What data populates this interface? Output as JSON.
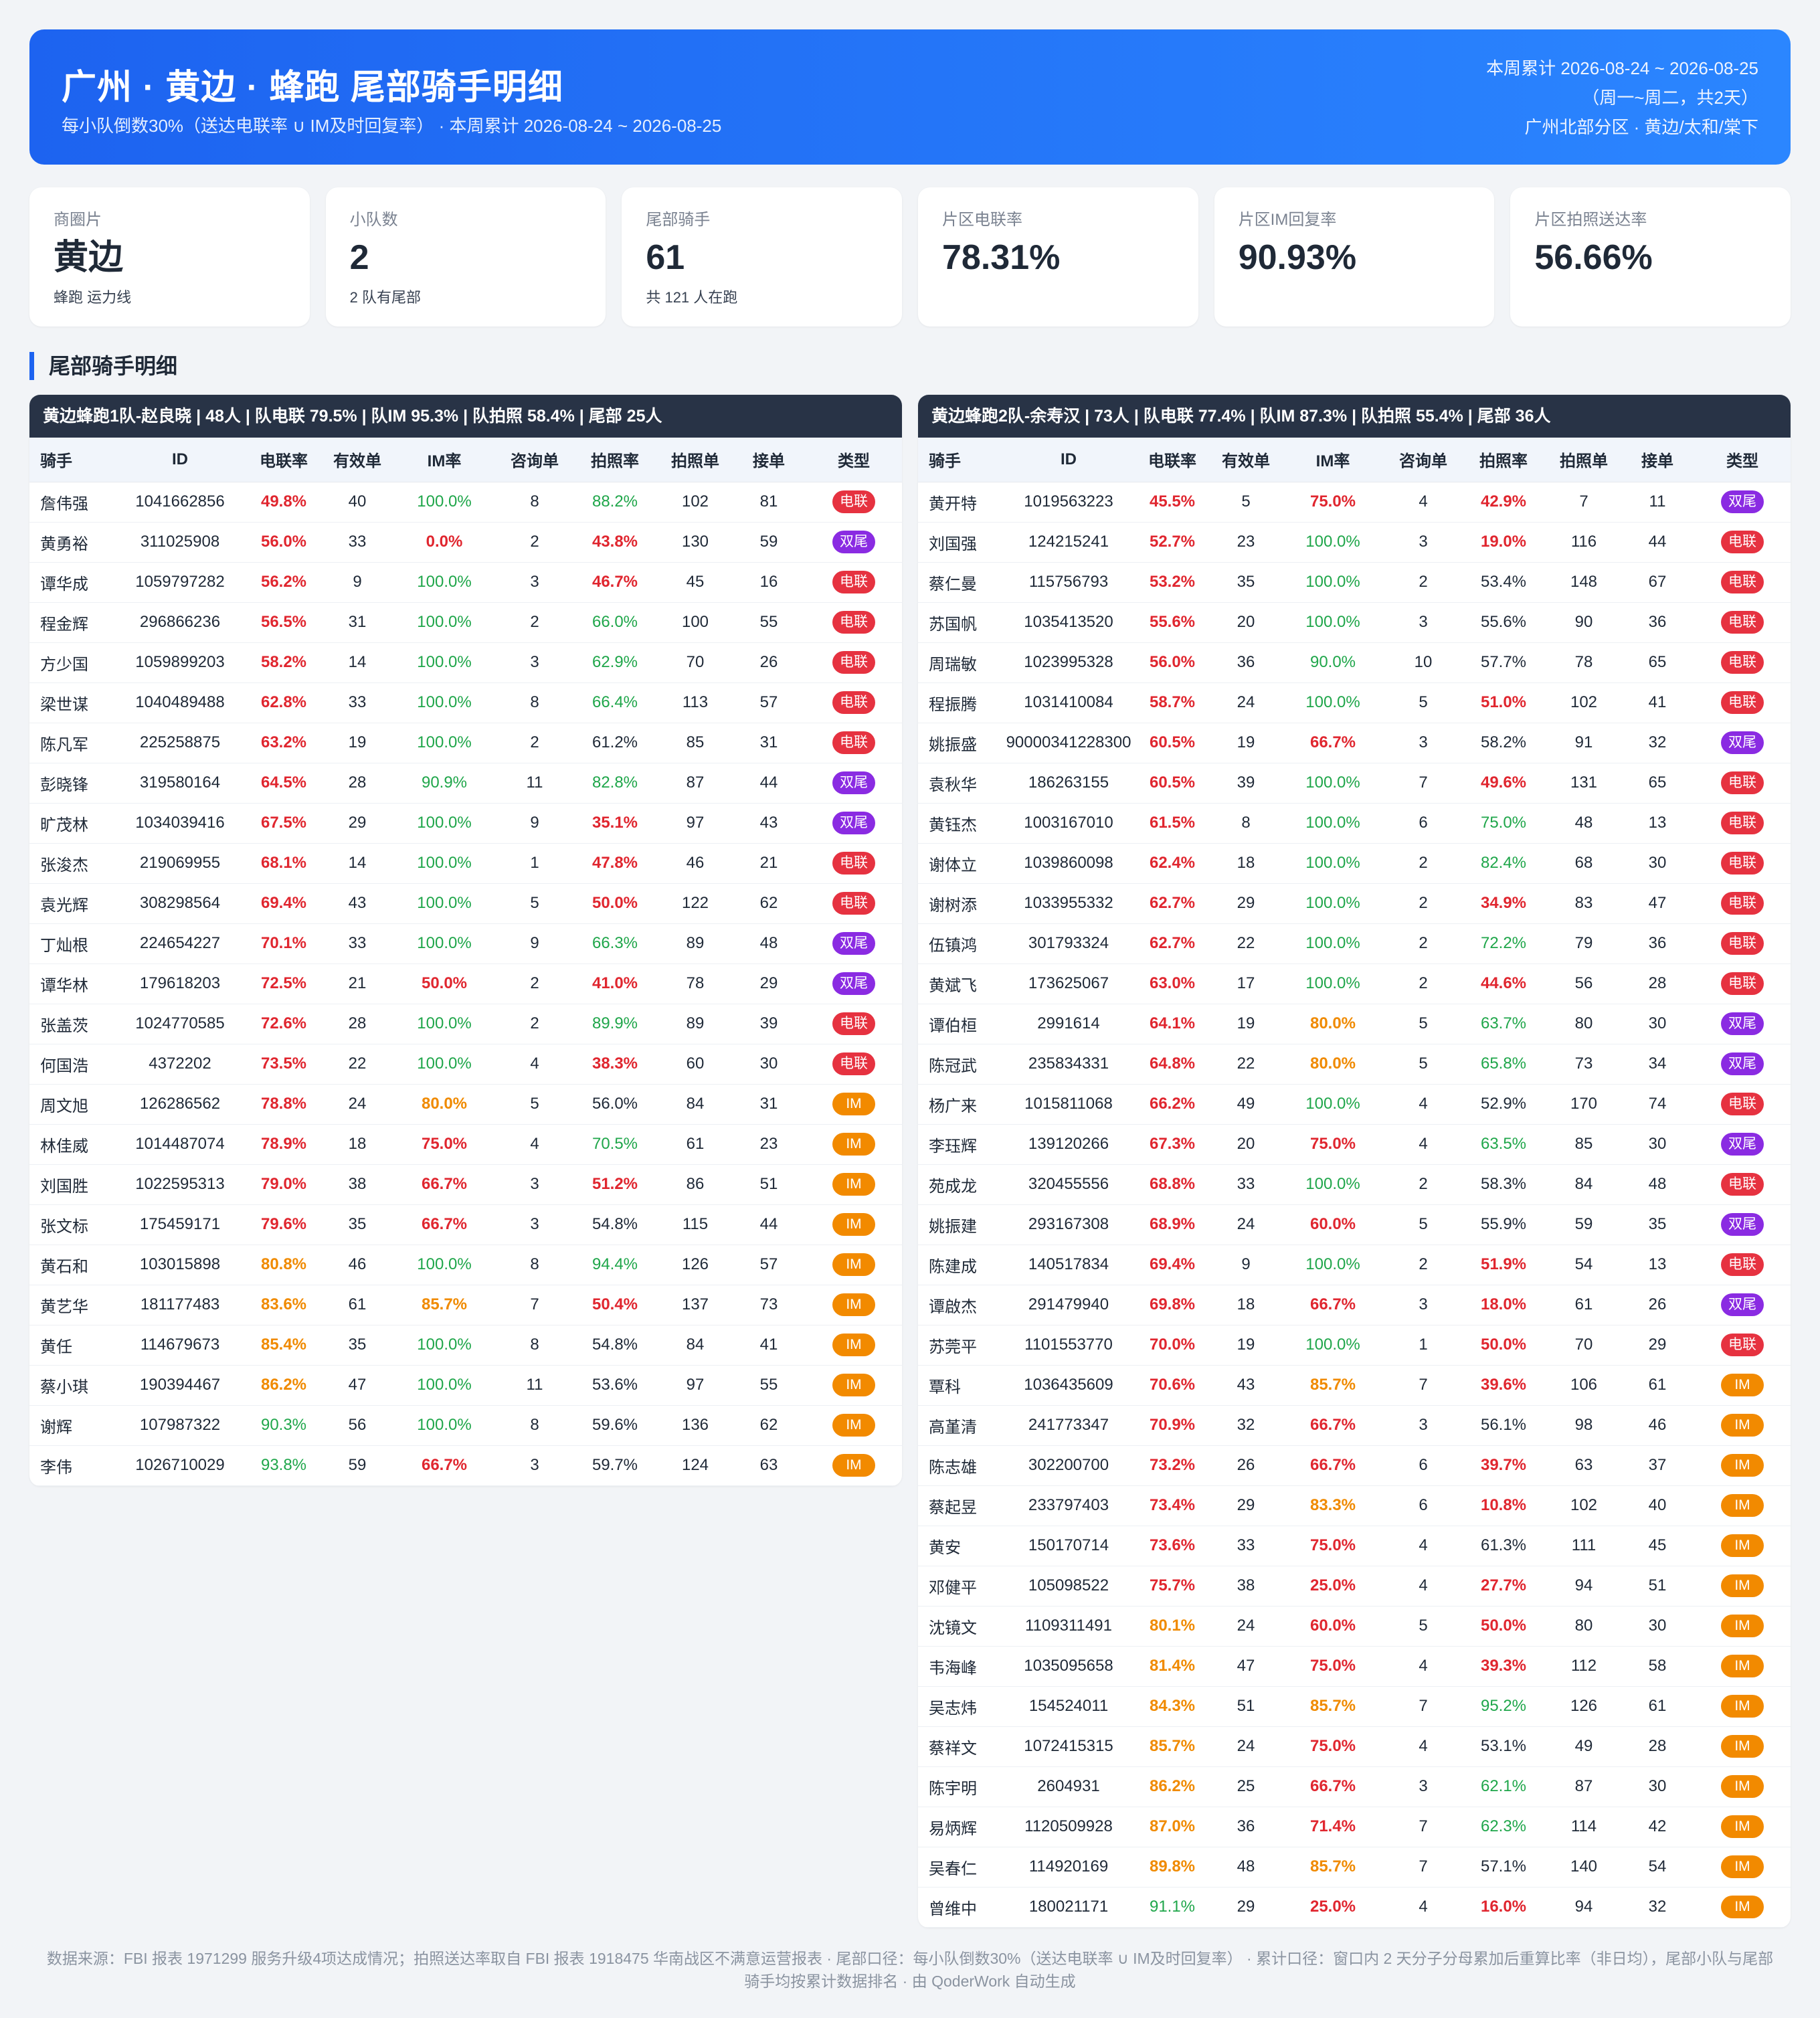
{
  "header": {
    "title": "广州 · 黄边 · 蜂跑 尾部骑手明细",
    "subtitle": "每小队倒数30%（送达电联率 ∪ IM及时回复率）   ·   本周累计 2026-08-24 ~ 2026-08-25",
    "right_line1": "本周累计 2026-08-24 ~ 2026-08-25",
    "right_line2": "（周一~周二，共2天）",
    "right_line3": "广州北部分区 · 黄边/太和/棠下"
  },
  "cards": [
    {
      "label": "商圈片",
      "value": "黄边",
      "note": "蜂跑 运力线"
    },
    {
      "label": "小队数",
      "value": "2",
      "note": "2 队有尾部"
    },
    {
      "label": "尾部骑手",
      "value": "61",
      "note": "共 121 人在跑"
    },
    {
      "label": "片区电联率",
      "value": "78.31%",
      "note": ""
    },
    {
      "label": "片区IM回复率",
      "value": "90.93%",
      "note": ""
    },
    {
      "label": "片区拍照送达率",
      "value": "56.66%",
      "note": ""
    }
  ],
  "section_title": "尾部骑手明细",
  "columns": [
    "骑手",
    "ID",
    "电联率",
    "有效单",
    "IM率",
    "咨询单",
    "拍照率",
    "拍照单",
    "接单",
    "类型"
  ],
  "type_labels": {
    "dl": "电联",
    "sw": "双尾",
    "im": "IM"
  },
  "colors": {
    "red": "#e0262f",
    "orange": "#f08a00",
    "green": "#1fa64a",
    "tag_dl": "#e63240",
    "tag_sw": "#8a2be2",
    "tag_im": "#f28a00",
    "header_start": "#1d63f0",
    "header_end": "#2b86ff",
    "team_bar": "#283346"
  },
  "teams": [
    {
      "summary": "黄边蜂跑1队-赵良晓  |  48人  |  队电联 79.5%  |  队IM 95.3%    |  队拍照 58.4%  |  尾部 25人",
      "rows": [
        [
          "詹伟强",
          "1041662856",
          "49.8%",
          "40",
          "100.0%",
          "8",
          "88.2%",
          "102",
          "81",
          "dl"
        ],
        [
          "黄勇裕",
          "311025908",
          "56.0%",
          "33",
          "0.0%",
          "2",
          "43.8%",
          "130",
          "59",
          "sw"
        ],
        [
          "谭华成",
          "1059797282",
          "56.2%",
          "9",
          "100.0%",
          "3",
          "46.7%",
          "45",
          "16",
          "dl"
        ],
        [
          "程金辉",
          "296866236",
          "56.5%",
          "31",
          "100.0%",
          "2",
          "66.0%",
          "100",
          "55",
          "dl"
        ],
        [
          "方少国",
          "1059899203",
          "58.2%",
          "14",
          "100.0%",
          "3",
          "62.9%",
          "70",
          "26",
          "dl"
        ],
        [
          "梁世谋",
          "1040489488",
          "62.8%",
          "33",
          "100.0%",
          "8",
          "66.4%",
          "113",
          "57",
          "dl"
        ],
        [
          "陈凡军",
          "225258875",
          "63.2%",
          "19",
          "100.0%",
          "2",
          "61.2%",
          "85",
          "31",
          "dl"
        ],
        [
          "彭晓锋",
          "319580164",
          "64.5%",
          "28",
          "90.9%",
          "11",
          "82.8%",
          "87",
          "44",
          "sw"
        ],
        [
          "旷茂林",
          "1034039416",
          "67.5%",
          "29",
          "100.0%",
          "9",
          "35.1%",
          "97",
          "43",
          "sw"
        ],
        [
          "张浚杰",
          "219069955",
          "68.1%",
          "14",
          "100.0%",
          "1",
          "47.8%",
          "46",
          "21",
          "dl"
        ],
        [
          "袁光辉",
          "308298564",
          "69.4%",
          "43",
          "100.0%",
          "5",
          "50.0%",
          "122",
          "62",
          "dl"
        ],
        [
          "丁灿根",
          "224654227",
          "70.1%",
          "33",
          "100.0%",
          "9",
          "66.3%",
          "89",
          "48",
          "sw"
        ],
        [
          "谭华林",
          "179618203",
          "72.5%",
          "21",
          "50.0%",
          "2",
          "41.0%",
          "78",
          "29",
          "sw"
        ],
        [
          "张盖茨",
          "1024770585",
          "72.6%",
          "28",
          "100.0%",
          "2",
          "89.9%",
          "89",
          "39",
          "dl"
        ],
        [
          "何国浩",
          "4372202",
          "73.5%",
          "22",
          "100.0%",
          "4",
          "38.3%",
          "60",
          "30",
          "dl"
        ],
        [
          "周文旭",
          "126286562",
          "78.8%",
          "24",
          "80.0%",
          "5",
          "56.0%",
          "84",
          "31",
          "im"
        ],
        [
          "林佳威",
          "1014487074",
          "78.9%",
          "18",
          "75.0%",
          "4",
          "70.5%",
          "61",
          "23",
          "im"
        ],
        [
          "刘国胜",
          "1022595313",
          "79.0%",
          "38",
          "66.7%",
          "3",
          "51.2%",
          "86",
          "51",
          "im"
        ],
        [
          "张文标",
          "175459171",
          "79.6%",
          "35",
          "66.7%",
          "3",
          "54.8%",
          "115",
          "44",
          "im"
        ],
        [
          "黄石和",
          "103015898",
          "80.8%",
          "46",
          "100.0%",
          "8",
          "94.4%",
          "126",
          "57",
          "im"
        ],
        [
          "黄艺华",
          "181177483",
          "83.6%",
          "61",
          "85.7%",
          "7",
          "50.4%",
          "137",
          "73",
          "im"
        ],
        [
          "黄任",
          "114679673",
          "85.4%",
          "35",
          "100.0%",
          "8",
          "54.8%",
          "84",
          "41",
          "im"
        ],
        [
          "蔡小琪",
          "190394467",
          "86.2%",
          "47",
          "100.0%",
          "11",
          "53.6%",
          "97",
          "55",
          "im"
        ],
        [
          "谢辉",
          "107987322",
          "90.3%",
          "56",
          "100.0%",
          "8",
          "59.6%",
          "136",
          "62",
          "im"
        ],
        [
          "李伟",
          "1026710029",
          "93.8%",
          "59",
          "66.7%",
          "3",
          "59.7%",
          "124",
          "63",
          "im"
        ]
      ]
    },
    {
      "summary": "黄边蜂跑2队-余寿汉  |  73人  |  队电联 77.4%  |  队IM 87.3%    |  队拍照 55.4%  |  尾部 36人",
      "rows": [
        [
          "黄开特",
          "1019563223",
          "45.5%",
          "5",
          "75.0%",
          "4",
          "42.9%",
          "7",
          "11",
          "sw"
        ],
        [
          "刘国强",
          "124215241",
          "52.7%",
          "23",
          "100.0%",
          "3",
          "19.0%",
          "116",
          "44",
          "dl"
        ],
        [
          "蔡仁曼",
          "115756793",
          "53.2%",
          "35",
          "100.0%",
          "2",
          "53.4%",
          "148",
          "67",
          "dl"
        ],
        [
          "苏国帆",
          "1035413520",
          "55.6%",
          "20",
          "100.0%",
          "3",
          "55.6%",
          "90",
          "36",
          "dl"
        ],
        [
          "周瑞敏",
          "1023995328",
          "56.0%",
          "36",
          "90.0%",
          "10",
          "57.7%",
          "78",
          "65",
          "dl"
        ],
        [
          "程振腾",
          "1031410084",
          "58.7%",
          "24",
          "100.0%",
          "5",
          "51.0%",
          "102",
          "41",
          "dl"
        ],
        [
          "姚振盛",
          "90000341228300",
          "60.5%",
          "19",
          "66.7%",
          "3",
          "58.2%",
          "91",
          "32",
          "sw"
        ],
        [
          "袁秋华",
          "186263155",
          "60.5%",
          "39",
          "100.0%",
          "7",
          "49.6%",
          "131",
          "65",
          "dl"
        ],
        [
          "黄钰杰",
          "1003167010",
          "61.5%",
          "8",
          "100.0%",
          "6",
          "75.0%",
          "48",
          "13",
          "dl"
        ],
        [
          "谢体立",
          "1039860098",
          "62.4%",
          "18",
          "100.0%",
          "2",
          "82.4%",
          "68",
          "30",
          "dl"
        ],
        [
          "谢树添",
          "1033955332",
          "62.7%",
          "29",
          "100.0%",
          "2",
          "34.9%",
          "83",
          "47",
          "dl"
        ],
        [
          "伍镇鸿",
          "301793324",
          "62.7%",
          "22",
          "100.0%",
          "2",
          "72.2%",
          "79",
          "36",
          "dl"
        ],
        [
          "黄斌飞",
          "173625067",
          "63.0%",
          "17",
          "100.0%",
          "2",
          "44.6%",
          "56",
          "28",
          "dl"
        ],
        [
          "谭伯桓",
          "2991614",
          "64.1%",
          "19",
          "80.0%",
          "5",
          "63.7%",
          "80",
          "30",
          "sw"
        ],
        [
          "陈冠武",
          "235834331",
          "64.8%",
          "22",
          "80.0%",
          "5",
          "65.8%",
          "73",
          "34",
          "sw"
        ],
        [
          "杨广来",
          "1015811068",
          "66.2%",
          "49",
          "100.0%",
          "4",
          "52.9%",
          "170",
          "74",
          "dl"
        ],
        [
          "李珏辉",
          "139120266",
          "67.3%",
          "20",
          "75.0%",
          "4",
          "63.5%",
          "85",
          "30",
          "sw"
        ],
        [
          "苑成龙",
          "320455556",
          "68.8%",
          "33",
          "100.0%",
          "2",
          "58.3%",
          "84",
          "48",
          "dl"
        ],
        [
          "姚振建",
          "293167308",
          "68.9%",
          "24",
          "60.0%",
          "5",
          "55.9%",
          "59",
          "35",
          "sw"
        ],
        [
          "陈建成",
          "140517834",
          "69.4%",
          "9",
          "100.0%",
          "2",
          "51.9%",
          "54",
          "13",
          "dl"
        ],
        [
          "谭啟杰",
          "291479940",
          "69.8%",
          "18",
          "66.7%",
          "3",
          "18.0%",
          "61",
          "26",
          "sw"
        ],
        [
          "苏莞平",
          "1101553770",
          "70.0%",
          "19",
          "100.0%",
          "1",
          "50.0%",
          "70",
          "29",
          "dl"
        ],
        [
          "覃科",
          "1036435609",
          "70.6%",
          "43",
          "85.7%",
          "7",
          "39.6%",
          "106",
          "61",
          "im"
        ],
        [
          "高堇清",
          "241773347",
          "70.9%",
          "32",
          "66.7%",
          "3",
          "56.1%",
          "98",
          "46",
          "im"
        ],
        [
          "陈志雄",
          "302200700",
          "73.2%",
          "26",
          "66.7%",
          "6",
          "39.7%",
          "63",
          "37",
          "im"
        ],
        [
          "蔡起昱",
          "233797403",
          "73.4%",
          "29",
          "83.3%",
          "6",
          "10.8%",
          "102",
          "40",
          "im"
        ],
        [
          "黄安",
          "150170714",
          "73.6%",
          "33",
          "75.0%",
          "4",
          "61.3%",
          "111",
          "45",
          "im"
        ],
        [
          "邓健平",
          "105098522",
          "75.7%",
          "38",
          "25.0%",
          "4",
          "27.7%",
          "94",
          "51",
          "im"
        ],
        [
          "沈镜文",
          "1109311491",
          "80.1%",
          "24",
          "60.0%",
          "5",
          "50.0%",
          "80",
          "30",
          "im"
        ],
        [
          "韦海峰",
          "1035095658",
          "81.4%",
          "47",
          "75.0%",
          "4",
          "39.3%",
          "112",
          "58",
          "im"
        ],
        [
          "吴志炜",
          "154524011",
          "84.3%",
          "51",
          "85.7%",
          "7",
          "95.2%",
          "126",
          "61",
          "im"
        ],
        [
          "蔡祥文",
          "1072415315",
          "85.7%",
          "24",
          "75.0%",
          "4",
          "53.1%",
          "49",
          "28",
          "im"
        ],
        [
          "陈宇明",
          "2604931",
          "86.2%",
          "25",
          "66.7%",
          "3",
          "62.1%",
          "87",
          "30",
          "im"
        ],
        [
          "易炳辉",
          "1120509928",
          "87.0%",
          "36",
          "71.4%",
          "7",
          "62.3%",
          "114",
          "42",
          "im"
        ],
        [
          "吴春仁",
          "114920169",
          "89.8%",
          "48",
          "85.7%",
          "7",
          "57.1%",
          "140",
          "54",
          "im"
        ],
        [
          "曾维中",
          "180021171",
          "91.1%",
          "29",
          "25.0%",
          "4",
          "16.0%",
          "94",
          "32",
          "im"
        ]
      ]
    }
  ],
  "footer_line1": "数据来源：FBI 报表 1971299 服务升级4项达成情况；拍照送达率取自 FBI 报表 1918475 华南战区不满意运营报表 · 尾部口径：每小队倒数30%（送达电联率 ∪ IM及时回复率）   ·   累计口径：窗口内 2 天分子分母累加后重算比率（非日均），尾部小队与尾部",
  "footer_line2": "骑手均按累计数据排名 · 由 QoderWork 自动生成"
}
